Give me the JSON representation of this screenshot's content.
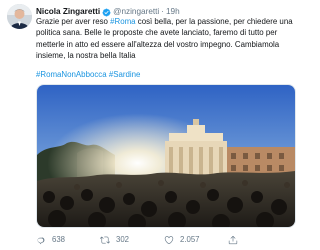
{
  "tweet": {
    "author_name": "Nicola Zingaretti",
    "handle": "@nzingaretti",
    "separator": "·",
    "time": "19h",
    "text": {
      "intro": "Grazie per aver reso ",
      "hashtag_inline": "#Roma",
      "rest": " così bella, per la passione, per chiedere una politica sana. Belle le proposte che avete lanciato, faremo di tutto per metterle in atto ed essere all'altezza del vostro impegno. Cambiamola insieme, la nostra bella Italia"
    },
    "hashtag_1": "#RomaNonAbbocca",
    "hashtag_2": "#Sardine",
    "colors": {
      "link": "#1b95e0",
      "verified": "#1da1f2",
      "muted": "#657786"
    }
  },
  "actions": {
    "reply": {
      "icon": "reply-icon",
      "count": "638"
    },
    "retweet": {
      "icon": "retweet-icon",
      "count": "302"
    },
    "like": {
      "icon": "heart-icon",
      "count": "2.057"
    },
    "share": {
      "icon": "share-icon"
    }
  }
}
